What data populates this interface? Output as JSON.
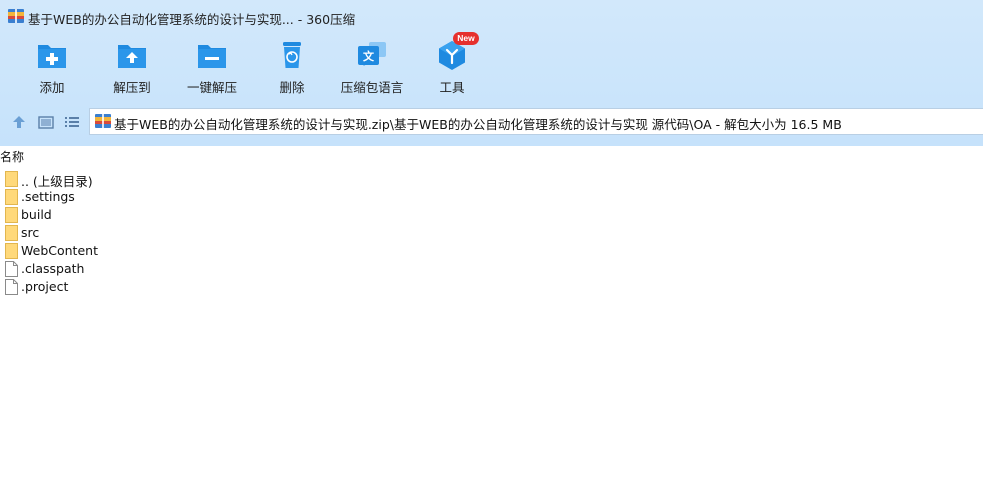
{
  "window": {
    "title": "基于WEB的办公自动化管理系统的设计与实现... - 360压缩"
  },
  "toolbar": {
    "items": [
      {
        "label": "添加",
        "icon": "add-folder-icon"
      },
      {
        "label": "解压到",
        "icon": "extract-to-icon"
      },
      {
        "label": "一键解压",
        "icon": "one-click-extract-icon"
      },
      {
        "label": "删除",
        "icon": "delete-icon"
      },
      {
        "label": "压缩包语言",
        "icon": "archive-language-icon"
      },
      {
        "label": "工具",
        "icon": "tools-icon"
      }
    ],
    "new_badge": "New"
  },
  "address": {
    "path": "基于WEB的办公自动化管理系统的设计与实现.zip\\基于WEB的办公自动化管理系统的设计与实现 源代码\\OA - 解包大小为 16.5 MB"
  },
  "file_list": {
    "column_name": "名称",
    "rows": [
      {
        "name": ".. (上级目录)",
        "type": "folder"
      },
      {
        "name": ".settings",
        "type": "folder"
      },
      {
        "name": "build",
        "type": "folder"
      },
      {
        "name": "src",
        "type": "folder"
      },
      {
        "name": "WebContent",
        "type": "folder"
      },
      {
        "name": ".classpath",
        "type": "file"
      },
      {
        "name": ".project",
        "type": "file"
      }
    ]
  },
  "colors": {
    "accent_blue": "#1f8ae0",
    "folder_yellow": "#ffd97a",
    "badge_red": "#e6302d"
  }
}
